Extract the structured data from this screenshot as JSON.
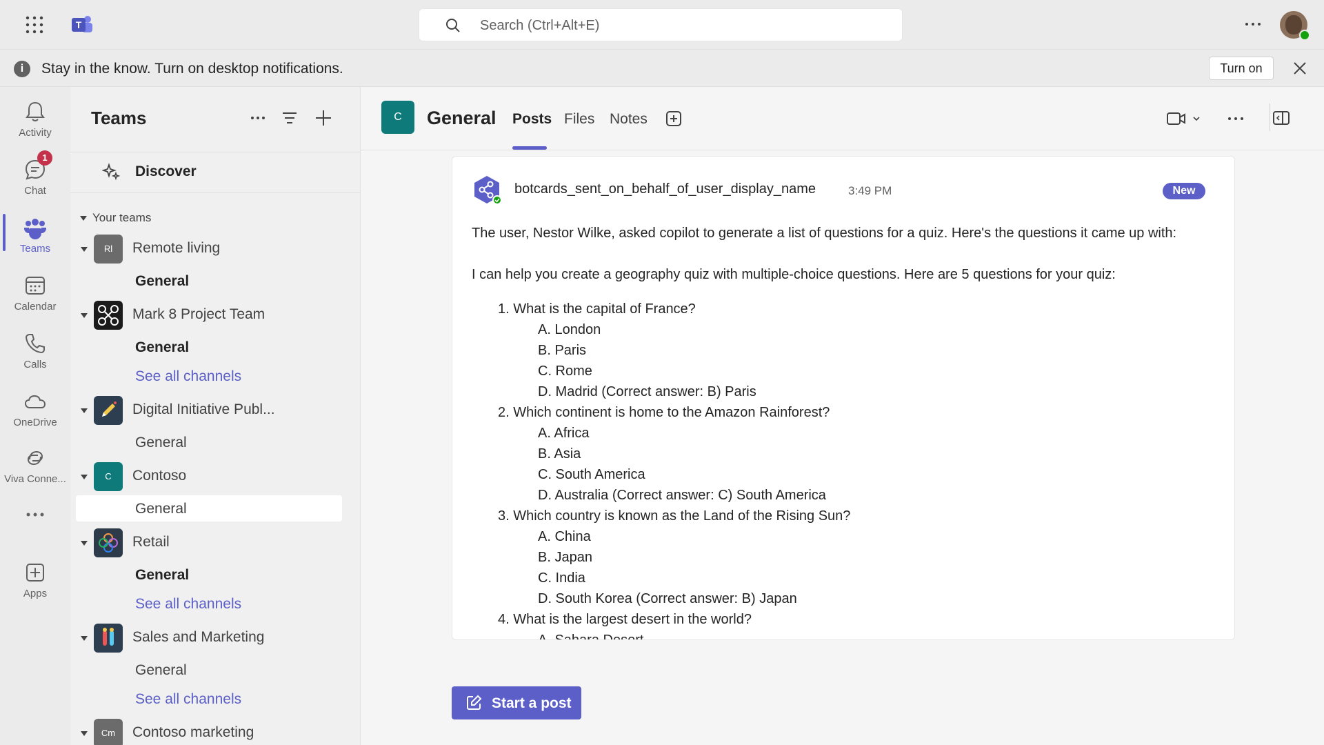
{
  "topbar": {
    "search_placeholder": "Search (Ctrl+Alt+E)"
  },
  "notification": {
    "message": "Stay in the know. Turn on desktop notifications.",
    "turn_on_label": "Turn on"
  },
  "rail": {
    "items": [
      {
        "label": "Activity",
        "icon": "bell-icon"
      },
      {
        "label": "Chat",
        "icon": "chat-icon",
        "badge": "1"
      },
      {
        "label": "Teams",
        "icon": "teams-icon"
      },
      {
        "label": "Calendar",
        "icon": "calendar-icon"
      },
      {
        "label": "Calls",
        "icon": "phone-icon"
      },
      {
        "label": "OneDrive",
        "icon": "cloud-icon"
      },
      {
        "label": "Viva Conne...",
        "icon": "viva-icon"
      },
      {
        "label": "Apps",
        "icon": "apps-icon"
      }
    ]
  },
  "sidebar": {
    "title": "Teams",
    "discover": "Discover",
    "your_teams": "Your teams",
    "teams": [
      {
        "name": "Remote living",
        "avatar": "Rl",
        "channels": [
          "General"
        ]
      },
      {
        "name": "Mark 8 Project Team",
        "channels": [
          "General",
          "See all channels"
        ]
      },
      {
        "name": "Digital Initiative Publ...",
        "channels": [
          "General"
        ]
      },
      {
        "name": "Contoso",
        "avatar": "C",
        "channels": [
          "General"
        ]
      },
      {
        "name": "Retail",
        "channels": [
          "General",
          "See all channels"
        ]
      },
      {
        "name": "Sales and Marketing",
        "channels": [
          "General",
          "See all channels"
        ]
      },
      {
        "name": "Contoso marketing",
        "avatar": "Cm",
        "channels": []
      }
    ]
  },
  "channel": {
    "avatar": "C",
    "name": "General",
    "tabs": [
      "Posts",
      "Files",
      "Notes"
    ]
  },
  "post": {
    "sender": "botcards_sent_on_behalf_of_user_display_name",
    "time": "3:49 PM",
    "badge": "New",
    "intro": "The user, Nestor Wilke, asked copilot to generate a list of questions for a quiz. Here's the questions it came up with:",
    "lead": "I can help you create a geography quiz with multiple-choice questions. Here are 5 questions for your quiz:",
    "questions": [
      {
        "q": "1. What is the capital of France?",
        "options": [
          "A. London",
          "B. Paris",
          "C. Rome",
          "D. Madrid (Correct answer: B) Paris"
        ]
      },
      {
        "q": "2. Which continent is home to the Amazon Rainforest?",
        "options": [
          "A. Africa",
          "B. Asia",
          "C. South America",
          "D. Australia (Correct answer: C) South America"
        ]
      },
      {
        "q": "3. Which country is known as the Land of the Rising Sun?",
        "options": [
          "A. China",
          "B. Japan",
          "C. India",
          "D. South Korea (Correct answer: B) Japan"
        ]
      },
      {
        "q": "4. What is the largest desert in the world?",
        "options": [
          "A. Sahara Desert"
        ]
      }
    ]
  },
  "compose": {
    "start_post": "Start a post"
  },
  "colors": {
    "brand": "#5b5fc7",
    "channel_avatar": "#0e7a7a",
    "badge_red": "#c4314b"
  }
}
